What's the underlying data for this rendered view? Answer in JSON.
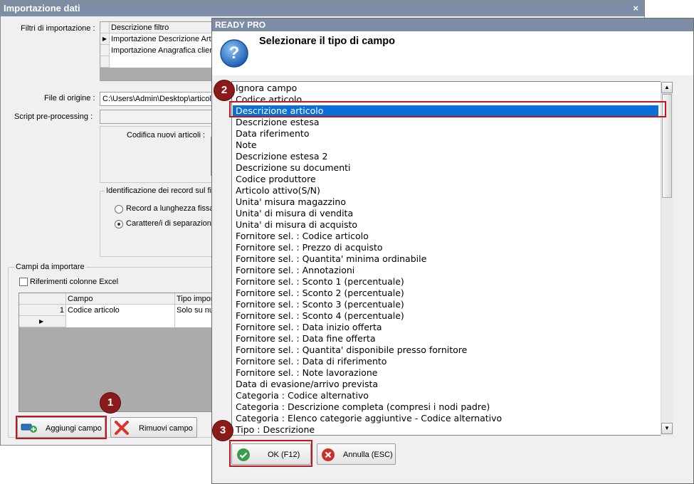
{
  "back_window": {
    "title": "Importazione dati",
    "close": "×",
    "filters_label": "Filtri di importazione :",
    "filters_header": "Descrizione filtro",
    "filters_rows": [
      "Importazione Descrizione Artic",
      "Importazione Anagrafica clien"
    ],
    "origin_label": "File di origine :",
    "origin_value": "C:\\Users\\Admin\\Desktop\\articoli",
    "script_label": "Script pre-processing :",
    "codifica_label": "Codifica nuovi articoli :",
    "ident_label": "Identificazione dei record sul file",
    "radio1": "Record a lunghezza fissa",
    "radio2": "Carattere/i di separazione",
    "campi_label": "Campi da importare",
    "excel_label": "Riferimenti colonne Excel",
    "table_headers": [
      "Campo",
      "Tipo impor"
    ],
    "table_row": {
      "num": "1",
      "campo": "Codice articolo",
      "tipo": "Solo su nu"
    },
    "row_arrow": "▶",
    "add_button": "Aggiungi campo",
    "remove_button": "Rimuovi campo"
  },
  "dialog": {
    "title": "READY PRO",
    "heading": "Selezionare il tipo di campo",
    "question_icon": "?",
    "selected_index": 2,
    "items": [
      "Ignora campo",
      "Codice articolo",
      "Descrizione articolo",
      "Descrizione estesa",
      "Data riferimento",
      "Note",
      "Descrizione estesa 2",
      "Descrizione su documenti",
      "Codice produttore",
      "Articolo attivo(S/N)",
      "Unita' misura magazzino",
      "Unita' di misura di vendita",
      "Unita' di misura di acquisto",
      "Fornitore sel. : Codice articolo",
      "Fornitore sel. : Prezzo di acquisto",
      "Fornitore sel. : Quantita' minima ordinabile",
      "Fornitore sel. : Annotazioni",
      "Fornitore sel. : Sconto 1 (percentuale)",
      "Fornitore sel. : Sconto 2 (percentuale)",
      "Fornitore sel. : Sconto 3 (percentuale)",
      "Fornitore sel. : Sconto 4 (percentuale)",
      "Fornitore sel. : Data inizio offerta",
      "Fornitore sel. : Data fine offerta",
      "Fornitore sel. : Quantita' disponibile presso fornitore",
      "Fornitore sel. : Data di riferimento",
      "Fornitore sel. : Note lavorazione",
      "Data di evasione/arrivo prevista",
      "Categoria : Codice alternativo",
      "Categoria : Descrizione completa (compresi i nodi padre)",
      "Categoria : Elenco categorie aggiuntive - Codice alternativo",
      "Tipo : Descrizione"
    ],
    "ok_button": "OK (F12)",
    "cancel_button": "Annulla (ESC)"
  },
  "badges": [
    "1",
    "2",
    "3"
  ],
  "colors": {
    "selection": "#0a6fd6",
    "highlight": "#c0161f",
    "badge": "#8b1a1a",
    "titlebar": "#7d8da6"
  }
}
